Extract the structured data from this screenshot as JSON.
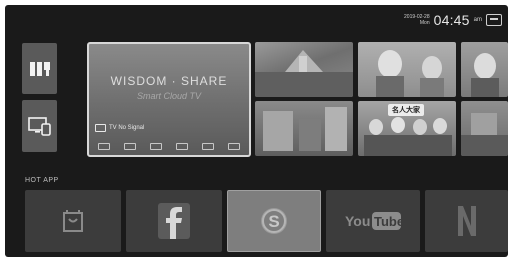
{
  "status": {
    "date": "2019-02-28",
    "weekday": "Mon",
    "time": "04:45",
    "ampm": "am"
  },
  "tv_card": {
    "title": "WISDOM · SHARE",
    "subtitle": "Smart Cloud TV",
    "signal_text": "TV No Signal"
  },
  "hot_app": {
    "label": "HOT APP",
    "apps": [
      {
        "name": "store"
      },
      {
        "name": "facebook"
      },
      {
        "name": "skype"
      },
      {
        "name": "youtube"
      },
      {
        "name": "netflix"
      }
    ]
  },
  "thumb_labels": {
    "badge": "名人大家"
  }
}
